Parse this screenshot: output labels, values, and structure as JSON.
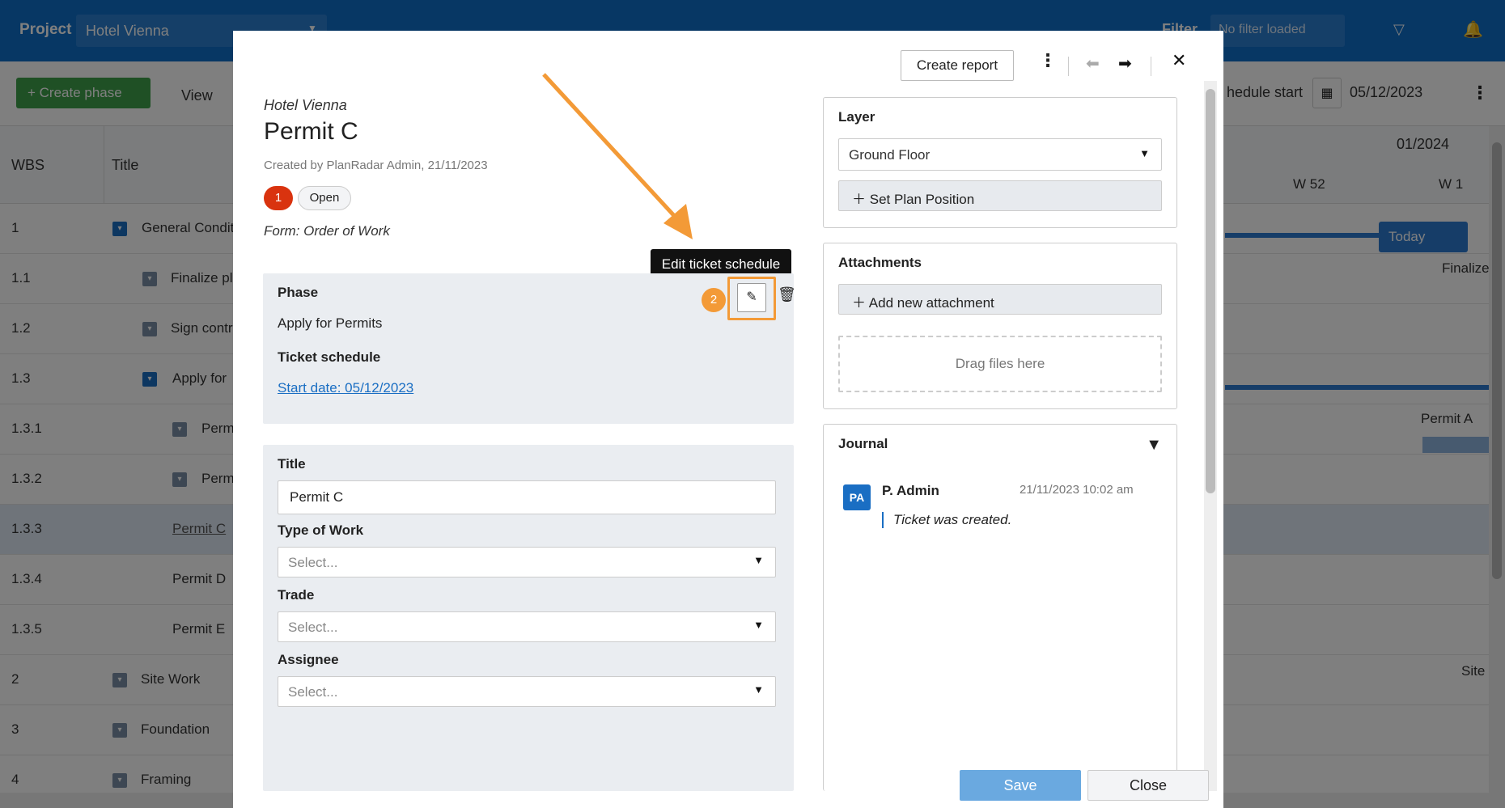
{
  "app": {
    "project_label": "Project",
    "project_value": "Hotel Vienna",
    "filter_label": "Filter",
    "filter_value": "No filter loaded",
    "create_phase": "+ Create phase",
    "view_label": "View",
    "schedule_label": "hedule start",
    "schedule_date": "05/12/2023",
    "col_wbs": "WBS",
    "col_title": "Title",
    "month": "01/2024",
    "week_a": "W 52",
    "week_b": "W 1",
    "today": "Today",
    "gantt_finalize": "Finalize",
    "gantt_permitA": "Permit A",
    "gantt_site": "Site",
    "rows": [
      {
        "wbs": "1",
        "title": "General Condit"
      },
      {
        "wbs": "1.1",
        "title": "Finalize pl"
      },
      {
        "wbs": "1.2",
        "title": "Sign contr"
      },
      {
        "wbs": "1.3",
        "title": "Apply for"
      },
      {
        "wbs": "1.3.1",
        "title": "Perm"
      },
      {
        "wbs": "1.3.2",
        "title": "Perm"
      },
      {
        "wbs": "1.3.3",
        "title": "Permit C"
      },
      {
        "wbs": "1.3.4",
        "title": "Permit D"
      },
      {
        "wbs": "1.3.5",
        "title": "Permit E"
      },
      {
        "wbs": "2",
        "title": "Site Work"
      },
      {
        "wbs": "3",
        "title": "Foundation"
      },
      {
        "wbs": "4",
        "title": "Framing"
      }
    ]
  },
  "modal": {
    "create_report": "Create report",
    "project_name": "Hotel Vienna",
    "ticket_title": "Permit C",
    "created_by": "Created by PlanRadar Admin, 21/11/2023",
    "badge_number": "1",
    "status": "Open",
    "form_line": "Form: Order of Work",
    "tooltip": "Edit ticket schedule",
    "step_number": "2",
    "phase_label": "Phase",
    "phase_value": "Apply for Permits",
    "schedule_label": "Ticket schedule",
    "start_date_link": "Start date: 05/12/2023",
    "title_label": "Title",
    "title_value": "Permit C",
    "type_label": "Type of Work",
    "type_placeholder": "Select...",
    "trade_label": "Trade",
    "trade_placeholder": "Select...",
    "assignee_label": "Assignee",
    "assignee_placeholder": "Select...",
    "layer_title": "Layer",
    "layer_value": "Ground Floor",
    "set_plan": "Set Plan Position",
    "attachments_title": "Attachments",
    "add_attachment": "Add new attachment",
    "drag_files": "Drag files here",
    "journal_title": "Journal",
    "journal_avatar": "PA",
    "journal_author": "P. Admin",
    "journal_time": "21/11/2023 10:02 am",
    "journal_message": "Ticket was created.",
    "save": "Save",
    "close": "Close"
  },
  "colors": {
    "accent": "#1a6ec3",
    "highlight": "#f39a37",
    "badge_red": "#d9330f"
  }
}
